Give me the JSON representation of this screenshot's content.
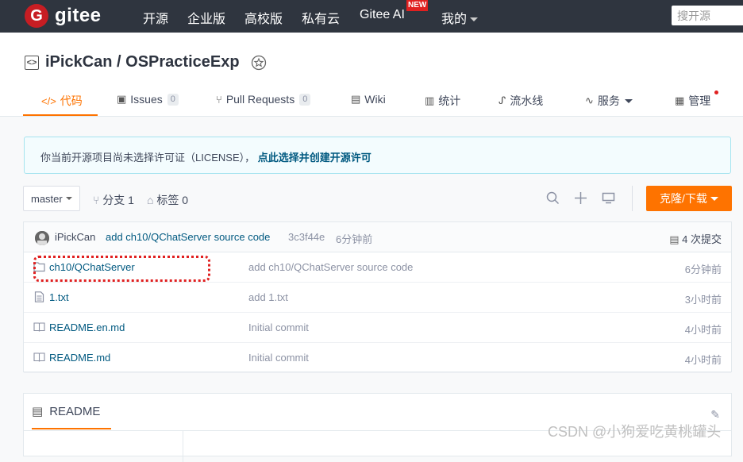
{
  "topbar": {
    "logo_mark": "G",
    "logo_text": "gitee",
    "nav": [
      "开源",
      "企业版",
      "高校版",
      "私有云",
      "Gitee AI",
      "我的"
    ],
    "new_badge": "NEW",
    "search_placeholder": "搜开源"
  },
  "repo": {
    "title": "iPickCan / OSPracticeExp",
    "tabs": {
      "code": "代码",
      "issues": "Issues",
      "issues_count": "0",
      "pulls": "Pull Requests",
      "pulls_count": "0",
      "wiki": "Wiki",
      "stats": "统计",
      "pipeline": "流水线",
      "services": "服务",
      "manage": "管理"
    }
  },
  "license_notice": {
    "text": "你当前开源项目尚未选择许可证（LICENSE），",
    "link": "点此选择并创建开源许可"
  },
  "toolbar": {
    "branch": "master",
    "branches": "分支 1",
    "tags": "标签 0",
    "clone_label": "克隆/下载"
  },
  "commit": {
    "author": "iPickCan",
    "message": "add ch10/QChatServer source code",
    "hash": "3c3f44e",
    "time": "6分钟前",
    "count": "4 次提交"
  },
  "files": [
    {
      "icon": "folder-icon",
      "name": "ch10/QChatServer",
      "message": "add ch10/QChatServer source code",
      "time": "6分钟前"
    },
    {
      "icon": "file-icon",
      "name": "1.txt",
      "message": "add 1.txt",
      "time": "3小时前"
    },
    {
      "icon": "book-icon",
      "name": "README.en.md",
      "message": "Initial commit",
      "time": "4小时前"
    },
    {
      "icon": "book-icon",
      "name": "README.md",
      "message": "Initial commit",
      "time": "4小时前"
    }
  ],
  "readme": {
    "tab_label": "README"
  },
  "watermark": "CSDN @小狗爱吃黄桃罐头",
  "colors": {
    "accent": "#fe7300",
    "topbar": "#2f353f",
    "link": "#005980",
    "highlight": "#e02020"
  }
}
